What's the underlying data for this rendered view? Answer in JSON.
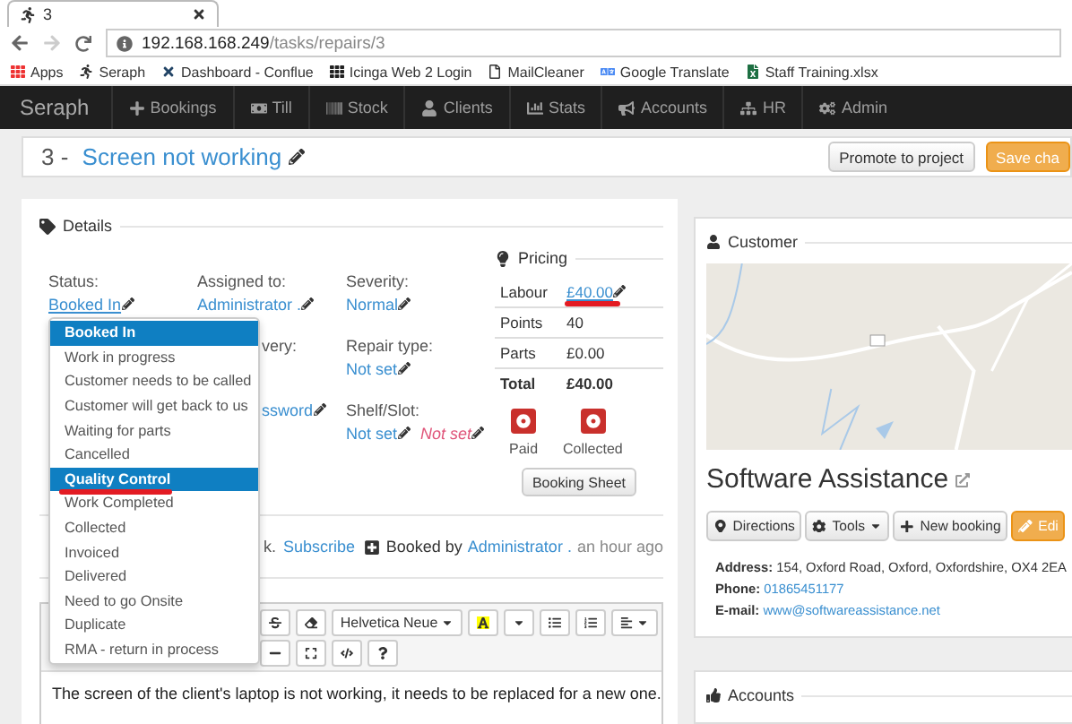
{
  "browser": {
    "tab_title": "3",
    "url_host": "192.168.168.249",
    "url_path": "/tasks/repairs/3",
    "bookmarks": [
      "Apps",
      "Seraph",
      "Dashboard - Conflue",
      "Icinga Web 2 Login",
      "MailCleaner",
      "Google Translate",
      "Staff Training.xlsx"
    ]
  },
  "navbar": {
    "brand": "Seraph",
    "items": [
      "Bookings",
      "Till",
      "Stock",
      "Clients",
      "Stats",
      "Accounts",
      "HR",
      "Admin"
    ]
  },
  "header": {
    "number": "3 - ",
    "title": "Screen not working",
    "buttons": [
      {
        "label": "Promote to project",
        "kind": "default"
      },
      {
        "label": "Save cha",
        "kind": "warning"
      }
    ]
  },
  "details": {
    "legend": "Details",
    "columns": [
      [
        {
          "label": "Status:",
          "value": "Booked In",
          "underlined": true
        }
      ],
      [
        {
          "label": "Assigned to:",
          "value": "Administrator .",
          "underlined": false
        },
        {
          "label": "very:"
        },
        {
          "value": "ssword",
          "underlined": false
        }
      ],
      [
        {
          "label": "Severity:",
          "value": "Normal",
          "underlined": false
        },
        {
          "label": "Repair type:",
          "value": "Not set",
          "underlined": false
        },
        {
          "label": "Shelf/Slot:",
          "value": "Not set",
          "underlined": false,
          "extra": "Not set"
        }
      ]
    ],
    "pricing": {
      "legend": "Pricing",
      "rows": [
        {
          "label": "Labour",
          "value": "£40.00",
          "link": true,
          "annotated": true,
          "bold": false
        },
        {
          "label": "Points",
          "value": "40",
          "link": false,
          "annotated": false,
          "bold": false
        },
        {
          "label": "Parts",
          "value": "£0.00",
          "link": false,
          "annotated": false,
          "bold": false
        },
        {
          "label": "Total",
          "value": "£40.00",
          "link": false,
          "annotated": false,
          "bold": true
        }
      ],
      "flags": [
        {
          "label": "Paid",
          "on": false
        },
        {
          "label": "Collected",
          "on": false
        }
      ],
      "sheet_button": "Booking Sheet"
    },
    "watch_text": "k.",
    "subscribe": "Subscribe",
    "booked": {
      "prefix": "Booked by",
      "user": "Administrator .",
      "time": "an hour ago"
    },
    "editor": {
      "font": "Helvetica Neue",
      "text": "The screen of the client's laptop is not working, it needs to be replaced for a new one."
    },
    "status_menu": [
      {
        "label": "Booked In",
        "selected": true,
        "annotated": false
      },
      {
        "label": "Work in progress",
        "selected": false,
        "annotated": false
      },
      {
        "label": "Customer needs to be called",
        "selected": false,
        "annotated": false
      },
      {
        "label": "Customer will get back to us",
        "selected": false,
        "annotated": false
      },
      {
        "label": "Waiting for parts",
        "selected": false,
        "annotated": false
      },
      {
        "label": "Cancelled",
        "selected": false,
        "annotated": false
      },
      {
        "label": "Quality Control",
        "selected": true,
        "annotated": true
      },
      {
        "label": "Work Completed",
        "selected": false,
        "annotated": false
      },
      {
        "label": "Collected",
        "selected": false,
        "annotated": false
      },
      {
        "label": "Invoiced",
        "selected": false,
        "annotated": false
      },
      {
        "label": "Delivered",
        "selected": false,
        "annotated": false
      },
      {
        "label": "Need to go Onsite",
        "selected": false,
        "annotated": false
      },
      {
        "label": "Duplicate",
        "selected": false,
        "annotated": false
      },
      {
        "label": "RMA - return in process",
        "selected": false,
        "annotated": false
      }
    ]
  },
  "customer": {
    "legend": "Customer",
    "name": "Software Assistance",
    "buttons": [
      {
        "label": "Directions",
        "kind": "default"
      },
      {
        "label": "Tools",
        "kind": "default"
      },
      {
        "label": "New booking",
        "kind": "default"
      },
      {
        "label": "Edi",
        "kind": "warning"
      }
    ],
    "info": [
      {
        "label": "Address:",
        "value": "154, Oxford Road, Oxford, Oxfordshire, OX4 2EA",
        "link": false
      },
      {
        "label": "Phone:",
        "value": "01865451177",
        "link": true
      },
      {
        "label": "E-mail:",
        "value": "www@softwareassistance.net",
        "link": true
      }
    ]
  },
  "accounts": {
    "legend": "Accounts"
  }
}
